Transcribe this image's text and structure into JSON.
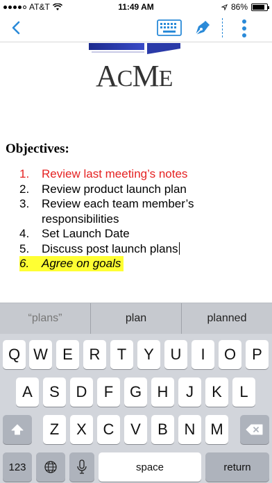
{
  "status_bar": {
    "carrier": "AT&T",
    "time": "11:49 AM",
    "battery": "86%",
    "battery_level": 0.86
  },
  "nav": {
    "icons": [
      "back-chevron-icon",
      "keyboard-icon",
      "pen-icon",
      "more-vertical-icon"
    ],
    "accent": "#2a8ad8"
  },
  "document": {
    "logo": {
      "text_large": "A",
      "text_c": "C",
      "text_m": "M",
      "text_e": "E"
    },
    "heading": "Objectives:",
    "items": [
      {
        "num": "1.",
        "text": "Review last meeting’s notes"
      },
      {
        "num": "2.",
        "text": "Review product launch plan"
      },
      {
        "num": "3.",
        "text": "Review each team member’s responsibilities"
      },
      {
        "num": "4.",
        "text": "Set Launch Date"
      },
      {
        "num": "5.",
        "text": "Discuss post launch plans"
      },
      {
        "num": "6.",
        "text": "Agree on goals"
      }
    ],
    "colors": {
      "red_item": "#e52222",
      "highlight": "#ffff33"
    }
  },
  "keyboard": {
    "predictions": [
      "“plans”",
      "plan",
      "planned"
    ],
    "row1": [
      "Q",
      "W",
      "E",
      "R",
      "T",
      "Y",
      "U",
      "I",
      "O",
      "P"
    ],
    "row2": [
      "A",
      "S",
      "D",
      "F",
      "G",
      "H",
      "J",
      "K",
      "L"
    ],
    "row3": [
      "Z",
      "X",
      "C",
      "V",
      "B",
      "N",
      "M"
    ],
    "numbers_label": "123",
    "space_label": "space",
    "return_label": "return"
  }
}
